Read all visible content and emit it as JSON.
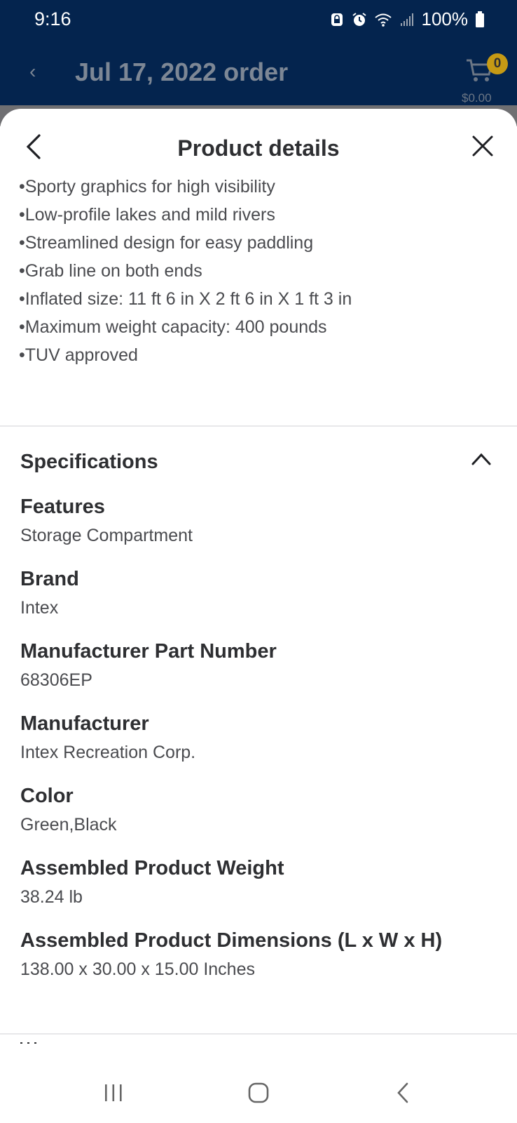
{
  "status_bar": {
    "time": "9:16",
    "battery": "100%"
  },
  "app_header": {
    "title": "Jul 17, 2022 order",
    "cart_count": "0",
    "cart_total": "$0.00"
  },
  "sheet": {
    "title": "Product details",
    "bullets": [
      "•Sporty graphics for high visibility",
      "•Low-profile lakes and mild rivers",
      "•Streamlined design for easy paddling",
      "•Grab line on both ends",
      "•Inflated size: 11 ft 6 in X 2 ft 6 in X 1 ft 3 in",
      "•Maximum weight capacity: 400 pounds",
      "•TUV approved"
    ],
    "specifications_heading": "Specifications",
    "specifications": [
      {
        "label": "Features",
        "value": "Storage Compartment"
      },
      {
        "label": "Brand",
        "value": "Intex"
      },
      {
        "label": "Manufacturer Part Number",
        "value": "68306EP"
      },
      {
        "label": "Manufacturer",
        "value": "Intex Recreation Corp."
      },
      {
        "label": "Color",
        "value": "Green,Black"
      },
      {
        "label": "Assembled Product Weight",
        "value": "38.24 lb"
      },
      {
        "label": "Assembled Product Dimensions (L x W x H)",
        "value": "138.00 x 30.00 x 15.00 Inches"
      }
    ]
  },
  "icons": {
    "status": [
      "lock-icon",
      "alarm-icon",
      "wifi-icon",
      "signal-icon",
      "battery-icon"
    ],
    "header": [
      "back-arrow-icon",
      "cart-icon"
    ],
    "sheet": [
      "chevron-left-icon",
      "close-icon",
      "chevron-up-icon"
    ],
    "nav": [
      "recents-icon",
      "home-icon",
      "back-icon"
    ]
  },
  "colors": {
    "header_bg": "#04244e",
    "badge": "#c69a14",
    "text_primary": "#2e2f32",
    "text_secondary": "#4a4b4f"
  }
}
